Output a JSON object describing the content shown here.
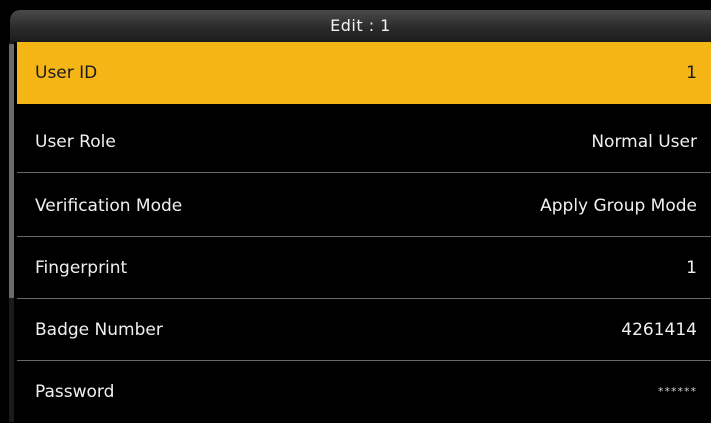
{
  "header": {
    "title": "Edit : 1"
  },
  "colors": {
    "selected": "#f5b515",
    "background": "#000000",
    "divider": "#6a6a6a"
  },
  "rows": [
    {
      "label": "User ID",
      "value": "1"
    },
    {
      "label": "User Role",
      "value": "Normal User"
    },
    {
      "label": "Verification Mode",
      "value": "Apply Group Mode"
    },
    {
      "label": "Fingerprint",
      "value": "1"
    },
    {
      "label": "Badge Number",
      "value": "4261414"
    },
    {
      "label": "Password",
      "value": "******"
    }
  ]
}
